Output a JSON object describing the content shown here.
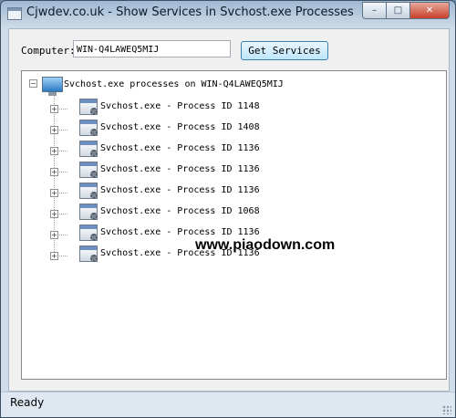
{
  "window": {
    "title": "Cjwdev.co.uk - Show Services in Svchost.exe Processes",
    "controls": {
      "minimize": "–",
      "maximize": "□",
      "close": "✕"
    }
  },
  "computer": {
    "label": "Computer:",
    "value": "WIN-Q4LAWEQ5MIJ",
    "button": "Get Services"
  },
  "tree": {
    "root_label": "Svchost.exe processes on WIN-Q4LAWEQ5MIJ",
    "items": [
      {
        "label": "Svchost.exe - Process ID 1148"
      },
      {
        "label": "Svchost.exe - Process ID 1408"
      },
      {
        "label": "Svchost.exe - Process ID 1136"
      },
      {
        "label": "Svchost.exe - Process ID 1136"
      },
      {
        "label": "Svchost.exe - Process ID 1136"
      },
      {
        "label": "Svchost.exe - Process ID 1068"
      },
      {
        "label": "Svchost.exe - Process ID 1136"
      },
      {
        "label": "Svchost.exe - Process ID 1136"
      }
    ]
  },
  "watermark": "www.piaodown.com",
  "status": {
    "text": "Ready"
  },
  "icons": {
    "app": "window-icon",
    "computer": "computer-icon",
    "process": "process-gear-icon"
  }
}
